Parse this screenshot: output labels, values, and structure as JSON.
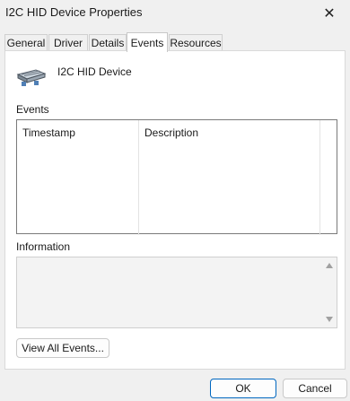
{
  "window": {
    "title": "I2C HID Device Properties",
    "close_glyph": "✕"
  },
  "tabs": [
    {
      "label": "General",
      "active": false
    },
    {
      "label": "Driver",
      "active": false
    },
    {
      "label": "Details",
      "active": false
    },
    {
      "label": "Events",
      "active": true
    },
    {
      "label": "Resources",
      "active": false
    }
  ],
  "device": {
    "name": "I2C HID Device",
    "icon": "hid-device-icon"
  },
  "events": {
    "label": "Events",
    "columns": [
      "Timestamp",
      "Description"
    ]
  },
  "information": {
    "label": "Information",
    "text": ""
  },
  "buttons": {
    "view_all_events": "View All Events...",
    "ok": "OK",
    "cancel": "Cancel"
  },
  "colors": {
    "window_bg": "#f0f0f0",
    "panel_bg": "#ffffff",
    "accent": "#0067c0",
    "info_bg": "#f3f3f3"
  }
}
